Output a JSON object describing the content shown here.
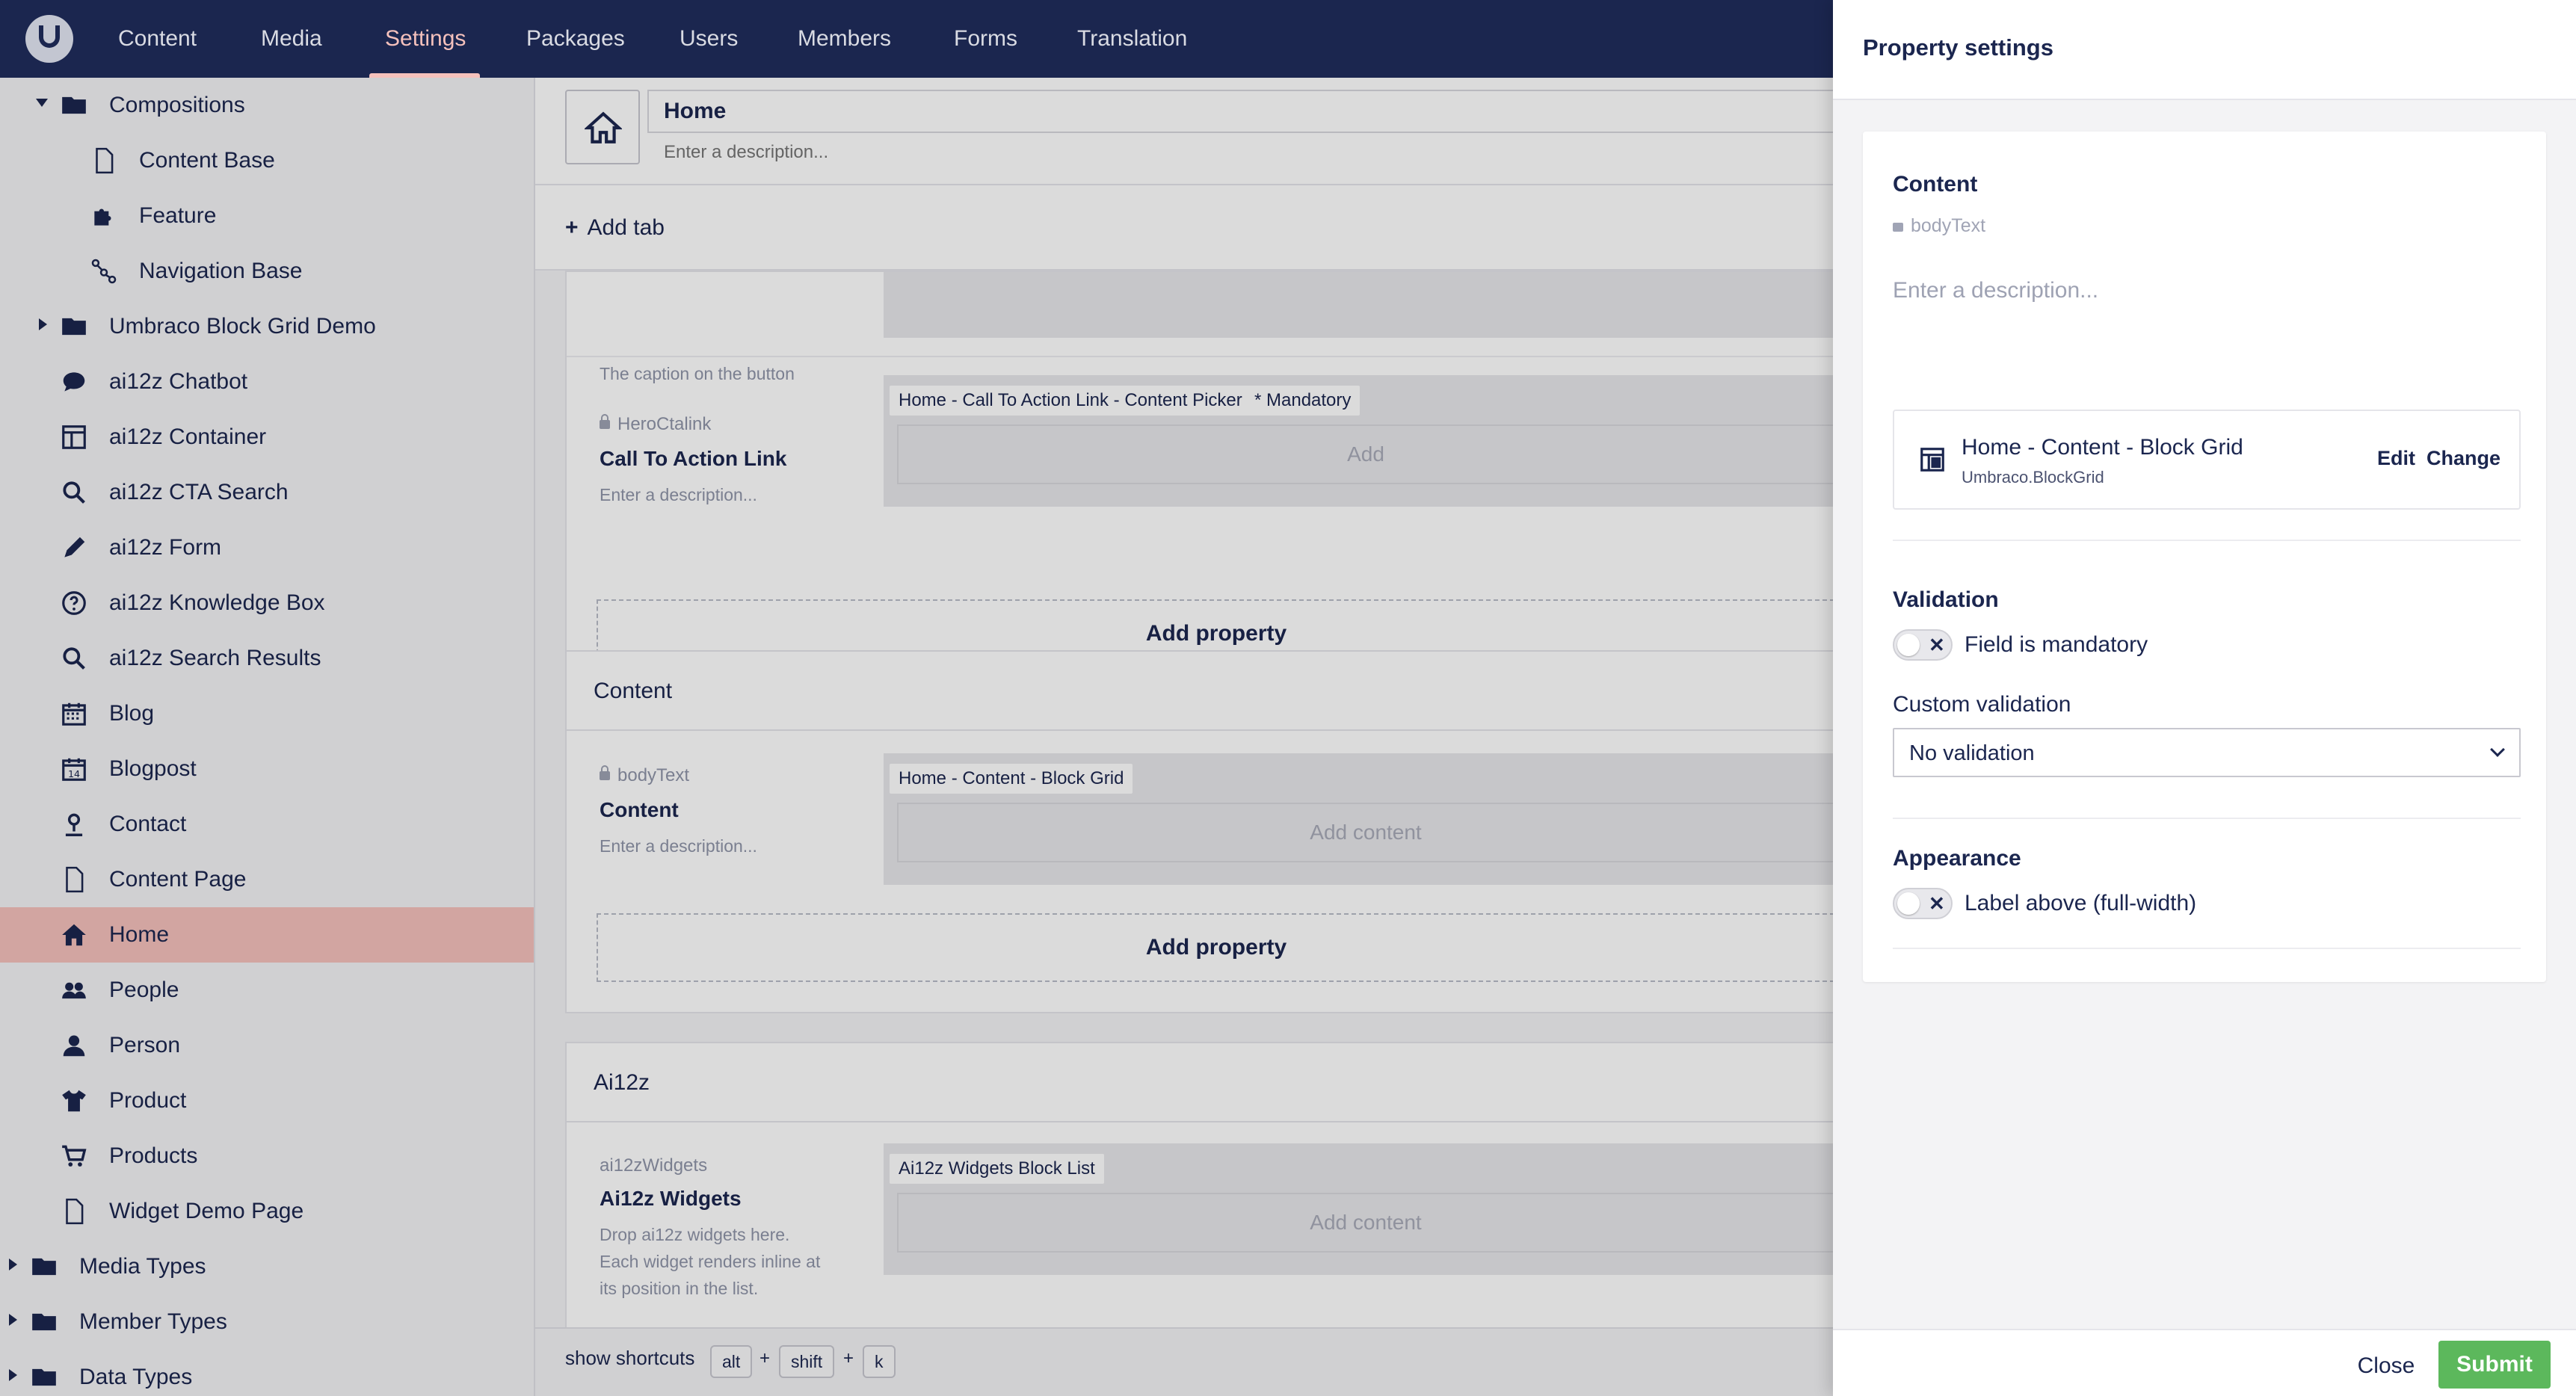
{
  "nav": {
    "items": [
      "Content",
      "Media",
      "Settings",
      "Packages",
      "Users",
      "Members",
      "Forms",
      "Translation"
    ],
    "active": "Settings"
  },
  "tree": {
    "items": [
      {
        "label": "Compositions",
        "icon": "folder-icon",
        "arrow": "down"
      },
      {
        "label": "Content Base",
        "icon": "document-icon"
      },
      {
        "label": "Feature",
        "icon": "puzzle-icon"
      },
      {
        "label": "Navigation Base",
        "icon": "sitemap-icon"
      },
      {
        "label": "Umbraco Block Grid Demo",
        "icon": "folder-icon",
        "arrow": "right"
      },
      {
        "label": "ai12z Chatbot",
        "icon": "chat-bubble-icon"
      },
      {
        "label": "ai12z Container",
        "icon": "layout-icon"
      },
      {
        "label": "ai12z CTA Search",
        "icon": "search-icon"
      },
      {
        "label": "ai12z Form",
        "icon": "pencil-icon"
      },
      {
        "label": "ai12z Knowledge Box",
        "icon": "help-circle-icon"
      },
      {
        "label": "ai12z Search Results",
        "icon": "search-icon"
      },
      {
        "label": "Blog",
        "icon": "calendar-icon"
      },
      {
        "label": "Blogpost",
        "icon": "calendar-day-icon"
      },
      {
        "label": "Contact",
        "icon": "map-pin-icon"
      },
      {
        "label": "Content Page",
        "icon": "document-icon"
      },
      {
        "label": "Home",
        "icon": "home-icon",
        "selected": true
      },
      {
        "label": "People",
        "icon": "people-icon"
      },
      {
        "label": "Person",
        "icon": "user-icon"
      },
      {
        "label": "Product",
        "icon": "shirt-icon"
      },
      {
        "label": "Products",
        "icon": "shopping-cart-icon"
      },
      {
        "label": "Widget Demo Page",
        "icon": "document-icon"
      },
      {
        "label": "Media Types",
        "icon": "folder-icon",
        "arrow": "right"
      },
      {
        "label": "Member Types",
        "icon": "folder-icon",
        "arrow": "right"
      },
      {
        "label": "Data Types",
        "icon": "folder-icon",
        "arrow": "right"
      }
    ]
  },
  "editor": {
    "name": "Home",
    "description_placeholder": "Enter a description...",
    "add_tab": "Add tab",
    "add_property": "Add property",
    "cta_group": {
      "caption_desc": "The caption on the button",
      "alias": "HeroCtalink",
      "name": "Call To Action Link",
      "description_placeholder": "Enter a description...",
      "editor_tag": "Home - Call To Action Link - Content Picker",
      "mandatory_tag": "* Mandatory",
      "add_label": "Add"
    },
    "content_group": {
      "title": "Content",
      "alias": "bodyText",
      "name": "Content",
      "description_placeholder": "Enter a description...",
      "editor_tag": "Home - Content - Block Grid",
      "add_label": "Add content"
    },
    "ai_group": {
      "title": "Ai12z",
      "alias": "ai12zWidgets",
      "name": "Ai12z Widgets",
      "description_lines": [
        "Drop ai12z widgets here.",
        "Each widget renders inline at",
        "its position in the list."
      ],
      "editor_tag": "Ai12z Widgets Block List",
      "add_label": "Add content"
    }
  },
  "shortcuts": {
    "label": "show shortcuts",
    "keys": [
      "alt",
      "shift",
      "k"
    ],
    "plus": "+"
  },
  "panel": {
    "title": "Property settings",
    "property_name": "Content",
    "property_alias": "bodyText",
    "description_placeholder": "Enter a description...",
    "editor_name": "Home - Content - Block Grid",
    "editor_alias": "Umbraco.BlockGrid",
    "edit_label": "Edit",
    "change_label": "Change",
    "validation_heading": "Validation",
    "mandatory_label": "Field is mandatory",
    "mandatory_on": false,
    "custom_validation_heading": "Custom validation",
    "custom_validation_value": "No validation",
    "appearance_heading": "Appearance",
    "label_above_label": "Label above (full-width)",
    "label_above_on": false,
    "close_label": "Close",
    "submit_label": "Submit"
  },
  "colors": {
    "topbar": "#1b264f",
    "active_nav": "#f5c1bc",
    "selected_row": "#f5c1bc",
    "submit": "#5cb85c"
  }
}
